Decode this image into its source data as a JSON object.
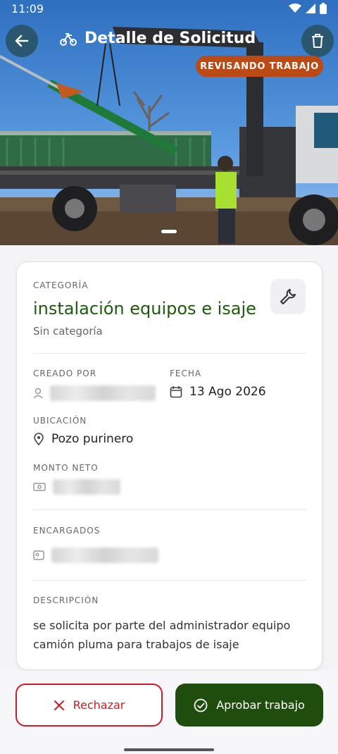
{
  "status_bar": {
    "time": "11:09"
  },
  "header": {
    "title": "Detalle de Solicitud",
    "status_badge": "REVISANDO TRABAJO"
  },
  "card": {
    "category_label": "CATEGORÍA",
    "category_name": "instalación equipos e isaje",
    "category_sub": "Sin categoría",
    "created_by_label": "CREADO POR",
    "date_label": "FECHA",
    "date_value": "13 Ago 2026",
    "location_label": "UBICACIÓN",
    "location_value": "Pozo purinero",
    "amount_label": "MONTO NETO",
    "managers_label": "ENCARGADOS",
    "description_label": "DESCRIPCIÓN",
    "description": "se solicita por parte del administrador equipo camión pluma para trabajos de isaje"
  },
  "actions": {
    "reject_label": "Rechazar",
    "approve_label": "Aprobar trabajo"
  },
  "colors": {
    "accent_green": "#1f4d0e",
    "badge_orange": "#bb4a14",
    "reject_red": "#c8202a"
  }
}
